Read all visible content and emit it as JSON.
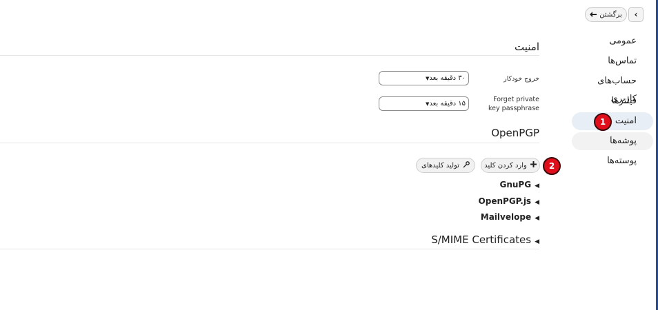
{
  "topbar": {
    "collapse_icon": "‹",
    "back_label": "برگشتن",
    "back_icon": "🡐"
  },
  "sidebar": {
    "items": [
      {
        "label": "عمومی"
      },
      {
        "label": "تماس‌ها"
      },
      {
        "label": "حساب‌های کاربری"
      },
      {
        "label": "فیلترها"
      },
      {
        "label": "امنیت"
      },
      {
        "label": "پوشه‌ها"
      },
      {
        "label": "پوسته‌ها"
      }
    ]
  },
  "markers": {
    "m1": "1",
    "m2": "2",
    "color": "#e00d1b"
  },
  "security": {
    "title": "امنیت",
    "auto_logout_label": "خروج خودکار",
    "auto_logout_value": "۳۰ دقیقه بعد",
    "forget_label": "Forget private key passphrase",
    "forget_value": "۱۵ دقیقه بعد"
  },
  "openpgp": {
    "title": "OpenPGP",
    "import_key_label": "وارد کردن کلید",
    "generate_keys_label": "تولید کلیدهای",
    "providers": [
      "GnuPG",
      "OpenPGP.js",
      "Mailvelope"
    ]
  },
  "smime": {
    "title": "S/MIME Certificates"
  },
  "colors": {
    "accent_edge": "#2a4d8f",
    "active_bg": "#e7eef6"
  }
}
